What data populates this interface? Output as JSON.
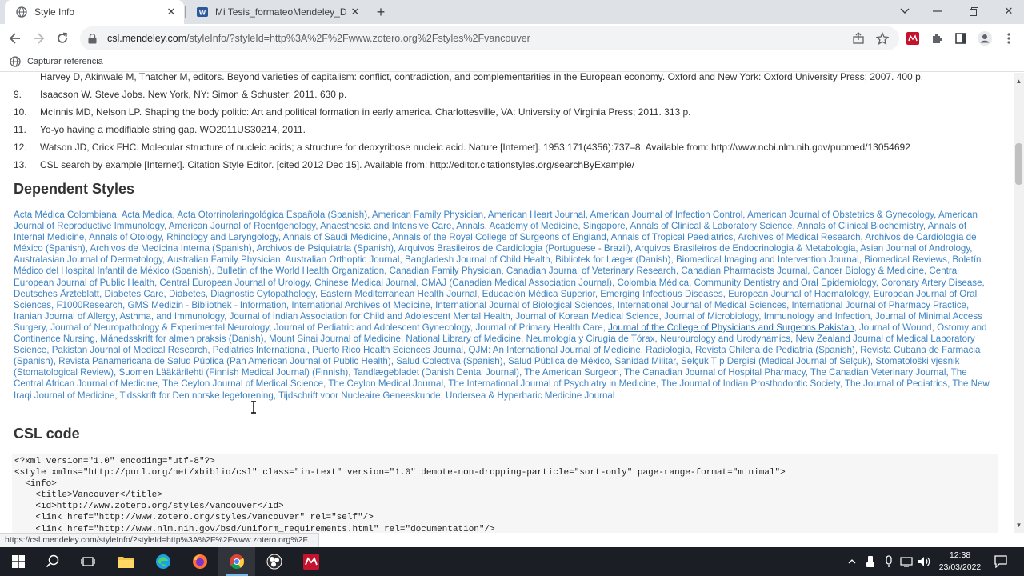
{
  "browser": {
    "tabs": [
      {
        "title": "Style Info",
        "active": true
      },
      {
        "title": "Mi Tesis_formateoMendeley_Doc",
        "active": false
      }
    ],
    "url_host": "csl.mendeley.com",
    "url_path": "/styleInfo/?styleId=http%3A%2F%2Fwww.zotero.org%2Fstyles%2Fvancouver",
    "bookmark": "Capturar referencia",
    "status_url": "https://csl.mendeley.com/styleInfo/?styleId=http%3A%2F%2Fwww.zotero.org%2F..."
  },
  "page": {
    "references": [
      {
        "num": "",
        "text": "Harvey D, Akinwale M, Thatcher M, editors. Beyond varieties of capitalism: conflict, contradiction, and complementarities in the European economy. Oxford and New York: Oxford University Press; 2007. 400 p."
      },
      {
        "num": "9.",
        "text": "Isaacson W. Steve Jobs. New York, NY: Simon & Schuster; 2011. 630 p."
      },
      {
        "num": "10.",
        "text": "McInnis MD, Nelson LP. Shaping the body politic: Art and political formation in early america. Charlottesville, VA: University of Virginia Press; 2011. 313 p."
      },
      {
        "num": "11.",
        "text": "Yo-yo having a modifiable string gap. WO2011US30214, 2011."
      },
      {
        "num": "12.",
        "text": "Watson JD, Crick FHC. Molecular structure of nucleic acids; a structure for deoxyribose nucleic acid. Nature [Internet]. 1953;171(4356):737–8. Available from: http://www.ncbi.nlm.nih.gov/pubmed/13054692"
      },
      {
        "num": "13.",
        "text": "CSL search by example [Internet]. Citation Style Editor. [cited 2012 Dec 15]. Available from: http://editor.citationstyles.org/searchByExample/"
      }
    ],
    "dependent_heading": "Dependent Styles",
    "dependent_styles": [
      "Acta Médica Colombiana",
      "Acta Medica",
      "Acta Otorrinolaringológica Española (Spanish)",
      "American Family Physician",
      "American Heart Journal",
      "American Journal of Infection Control",
      "American Journal of Obstetrics & Gynecology",
      "American Journal of Reproductive Immunology",
      "American Journal of Roentgenology",
      "Anaesthesia and Intensive Care",
      "Annals, Academy of Medicine, Singapore",
      "Annals of Clinical & Laboratory Science",
      "Annals of Clinical Biochemistry",
      "Annals of Internal Medicine",
      "Annals of Otology, Rhinology and Laryngology",
      "Annals of Saudi Medicine",
      "Annals of the Royal College of Surgeons of England",
      "Annals of Tropical Paediatrics",
      "Archives of Medical Research",
      "Archivos de Cardiología de México (Spanish)",
      "Archivos de Medicina Interna (Spanish)",
      "Archivos de Psiquiatría (Spanish)",
      "Arquivos Brasileiros de Cardiologia (Portuguese - Brazil)",
      "Arquivos Brasileiros de Endocrinologia & Metabologia",
      "Asian Journal of Andrology",
      "Australasian Journal of Dermatology",
      "Australian Family Physician",
      "Australian Orthoptic Journal",
      "Bangladesh Journal of Child Health",
      "Bibliotek for Læger (Danish)",
      "Biomedical Imaging and Intervention Journal",
      "Biomedical Reviews",
      "Boletín Médico del Hospital Infantil de México (Spanish)",
      "Bulletin of the World Health Organization",
      "Canadian Family Physician",
      "Canadian Journal of Veterinary Research",
      "Canadian Pharmacists Journal",
      "Cancer Biology & Medicine",
      "Central European Journal of Public Health",
      "Central European Journal of Urology",
      "Chinese Medical Journal",
      "CMAJ (Canadian Medical Association Journal)",
      "Colombia Médica",
      "Community Dentistry and Oral Epidemiology",
      "Coronary Artery Disease",
      "Deutsches Ärzteblatt",
      "Diabetes Care",
      "Diabetes",
      "Diagnostic Cytopathology",
      "Eastern Mediterranean Health Journal",
      "Educación Médica Superior",
      "Emerging Infectious Diseases",
      "European Journal of Haematology",
      "European Journal of Oral Sciences",
      "F1000Research",
      "GMS Medizin - Bibliothek - Information",
      "International Archives of Medicine",
      "International Journal of Biological Sciences",
      "International Journal of Medical Sciences",
      "International Journal of Pharmacy Practice",
      "Iranian Journal of Allergy, Asthma, and Immunology",
      "Journal of Indian Association for Child and Adolescent Mental Health",
      "Journal of Korean Medical Science",
      "Journal of Microbiology, Immunology and Infection",
      "Journal of Minimal Access Surgery",
      "Journal of Neuropathology & Experimental Neurology",
      "Journal of Pediatric and Adolescent Gynecology",
      "Journal of Primary Health Care",
      "Journal of the College of Physicians and Surgeons Pakistan",
      "Journal of Wound, Ostomy and Continence Nursing",
      "Månedsskrift for almen praksis (Danish)",
      "Mount Sinai Journal of Medicine",
      "National Library of Medicine",
      "Neumología y Cirugía de Tórax",
      "Neurourology and Urodynamics",
      "New Zealand Journal of Medical Laboratory Science",
      "Pakistan Journal of Medical Research",
      "Pediatrics International",
      "Puerto Rico Health Sciences Journal",
      "QJM: An International Journal of Medicine",
      "Radiología",
      "Revista Chilena de Pediatría (Spanish)",
      "Revista Cubana de Farmacia (Spanish)",
      "Revista Panamericana de Salud Pública (Pan American Journal of Public Health)",
      "Salud Colectiva (Spanish)",
      "Salud Pública de México",
      "Sanidad Militar",
      "Selçuk Tıp Dergisi (Medical Journal of Selçuk)",
      "Stomatološki vjesnik (Stomatological Review)",
      "Suomen Lääkärilehti (Finnish Medical Journal) (Finnish)",
      "Tandlægebladet (Danish Dental Journal)",
      "The American Surgeon",
      "The Canadian Journal of Hospital Pharmacy",
      "The Canadian Veterinary Journal",
      "The Central African Journal of Medicine",
      "The Ceylon Journal of Medical Science",
      "The Ceylon Medical Journal",
      "The International Journal of Psychiatry in Medicine",
      "The Journal of Indian Prosthodontic Society",
      "The Journal of Pediatrics",
      "The New Iraqi Journal of Medicine",
      "Tidsskrift for Den norske legeforening",
      "Tijdschrift voor Nucleaire Geneeskunde",
      "Undersea & Hyperbaric Medicine Journal"
    ],
    "hovered_style": "Journal of the College of Physicians and Surgeons Pakistan",
    "csl_heading": "CSL code",
    "csl_code": "<?xml version=\"1.0\" encoding=\"utf-8\"?>\n<style xmlns=\"http://purl.org/net/xbiblio/csl\" class=\"in-text\" version=\"1.0\" demote-non-dropping-particle=\"sort-only\" page-range-format=\"minimal\">\n  <info>\n    <title>Vancouver</title>\n    <id>http://www.zotero.org/styles/vancouver</id>\n    <link href=\"http://www.zotero.org/styles/vancouver\" rel=\"self\"/>\n    <link href=\"http://www.nlm.nih.gov/bsd/uniform_requirements.html\" rel=\"documentation\"/>"
  },
  "taskbar": {
    "time": "12:38",
    "date": "23/03/2022"
  },
  "colors": {
    "link": "#3e83c3",
    "tabstrip": "#dee1e6",
    "taskbar": "#1b1e24"
  },
  "icons": [
    "globe-icon",
    "word-icon",
    "close-icon",
    "plus-icon",
    "back-icon",
    "forward-icon",
    "reload-icon",
    "lock-icon",
    "share-icon",
    "star-icon",
    "mendeley-icon",
    "puzzle-icon",
    "sidepanel-icon",
    "profile-icon",
    "menu-icon",
    "windows-icon",
    "search-icon",
    "taskview-icon",
    "explorer-icon",
    "edge-icon",
    "firefox-icon",
    "chrome-icon",
    "obs-icon"
  ]
}
